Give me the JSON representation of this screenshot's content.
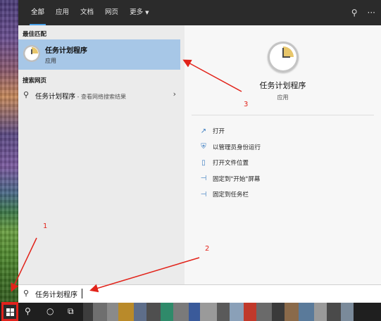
{
  "search_tabs": [
    {
      "label": "全部",
      "active": true
    },
    {
      "label": "应用",
      "active": false
    },
    {
      "label": "文档",
      "active": false
    },
    {
      "label": "网页",
      "active": false
    },
    {
      "label": "更多",
      "active": false,
      "has_dropdown": true
    }
  ],
  "top_icons": [
    {
      "name": "feedback-icon",
      "glyph": "⚲"
    },
    {
      "name": "more-options-icon",
      "glyph": "···"
    }
  ],
  "results": {
    "best_match_header": "最佳匹配",
    "best_match": {
      "name": "任务计划程序",
      "type": "应用",
      "icon": "task-scheduler-clock-icon"
    },
    "web_header": "搜索网页",
    "web_result": {
      "query": "任务计划程序",
      "suffix": " - 查看网络搜索结果"
    }
  },
  "detail": {
    "name": "任务计划程序",
    "type": "应用",
    "actions": [
      {
        "label": "打开",
        "icon": "open-icon",
        "glyph": "↗"
      },
      {
        "label": "以管理员身份运行",
        "icon": "run-as-admin-icon",
        "glyph": "⛨"
      },
      {
        "label": "打开文件位置",
        "icon": "file-location-icon",
        "glyph": "▯"
      },
      {
        "label": "固定到\"开始\"屏幕",
        "icon": "pin-start-icon",
        "glyph": "⊣"
      },
      {
        "label": "固定到任务栏",
        "icon": "pin-taskbar-icon",
        "glyph": "⊣"
      }
    ]
  },
  "search_box": {
    "value": "任务计划程序",
    "icon": "search-icon"
  },
  "taskbar": {
    "start_icon": "windows-logo-icon",
    "search_icon_glyph": "⚲",
    "cortana_glyph": "○",
    "taskview_glyph": "⧉"
  },
  "annotations": {
    "label_1": "1",
    "label_2": "2",
    "label_3": "3",
    "color": "#e2231a"
  }
}
